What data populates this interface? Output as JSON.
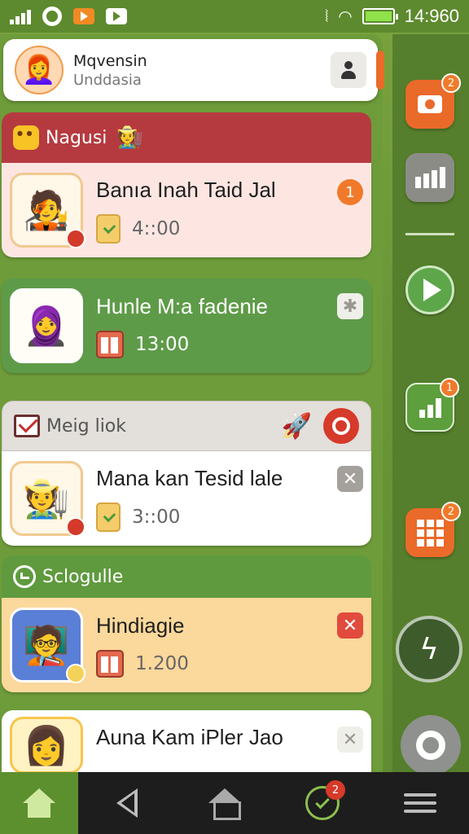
{
  "status_bar": {
    "time": "14:960",
    "icons": [
      "signal-icon",
      "gear-icon",
      "orange-play-icon",
      "play-icon",
      "vibrate-icon",
      "wifi-icon",
      "battery-icon"
    ]
  },
  "profile": {
    "name": "Mqvensin",
    "subtitle": "Unddasia",
    "avatar": "👩‍🦰"
  },
  "sections": [
    {
      "title": "Nagusi",
      "color": "#b53a40"
    },
    {
      "title": "Meig liok",
      "color": "#e3dfdb"
    },
    {
      "title": "Sclogulle",
      "color": "#5f9a3e"
    }
  ],
  "tasks": [
    {
      "title": "Banıa Inah Taid  Jal",
      "time": "4::00",
      "badge": "1",
      "avatar": "🧑‍🎤"
    },
    {
      "title": "Hunle M:a fadenie",
      "time": "13:00",
      "avatar": "🧕"
    },
    {
      "title": "Mana kan Tesid lale",
      "time": "3::00",
      "avatar": "🧑‍🌾"
    },
    {
      "title": "Hindiagie",
      "time": "1.200",
      "avatar": "🧑‍🏫"
    },
    {
      "title": "Auna Kam iPler Jao",
      "time": "",
      "avatar": "👩"
    }
  ],
  "rail": {
    "badges": {
      "camera": "2",
      "chart": "1",
      "grid": "2"
    }
  },
  "navbar": {
    "badge": "2"
  },
  "colors": {
    "accent_green": "#5f9a3e",
    "accent_orange": "#ea6a2a",
    "accent_red": "#b53a40"
  }
}
